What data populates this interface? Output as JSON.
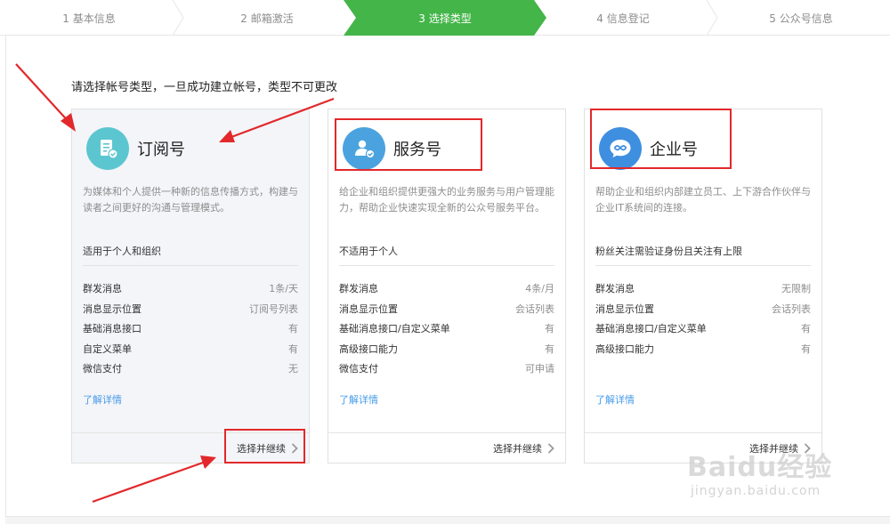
{
  "steps": [
    {
      "label": "1 基本信息"
    },
    {
      "label": "2 邮箱激活"
    },
    {
      "label": "3 选择类型"
    },
    {
      "label": "4 信息登记"
    },
    {
      "label": "5 公众号信息"
    }
  ],
  "intro": "请选择帐号类型，一旦成功建立帐号，类型不可更改",
  "cards": [
    {
      "icon": "subscription-doc-icon",
      "icon_color": "#5cc6d0",
      "title": "订阅号",
      "desc": "为媒体和个人提供一种新的信息传播方式，构建与读者之间更好的沟通与管理模式。",
      "suit": "适用于个人和组织",
      "features": [
        {
          "k": "群发消息",
          "v": "1条/天"
        },
        {
          "k": "消息显示位置",
          "v": "订阅号列表"
        },
        {
          "k": "基础消息接口",
          "v": "有"
        },
        {
          "k": "自定义菜单",
          "v": "有"
        },
        {
          "k": "微信支付",
          "v": "无"
        }
      ],
      "more": "了解详情",
      "continue": "选择并继续"
    },
    {
      "icon": "service-person-icon",
      "icon_color": "#4aa3df",
      "title": "服务号",
      "desc": "给企业和组织提供更强大的业务服务与用户管理能力，帮助企业快速实现全新的公众号服务平台。",
      "suit": "不适用于个人",
      "features": [
        {
          "k": "群发消息",
          "v": "4条/月"
        },
        {
          "k": "消息显示位置",
          "v": "会话列表"
        },
        {
          "k": "基础消息接口/自定义菜单",
          "v": "有"
        },
        {
          "k": "高级接口能力",
          "v": "有"
        },
        {
          "k": "微信支付",
          "v": "可申请"
        }
      ],
      "more": "了解详情",
      "continue": "选择并继续"
    },
    {
      "icon": "enterprise-chat-icon",
      "icon_color": "#3f8fe0",
      "title": "企业号",
      "desc": "帮助企业和组织内部建立员工、上下游合作伙伴与企业IT系统间的连接。",
      "suit": "粉丝关注需验证身份且关注有上限",
      "features": [
        {
          "k": "群发消息",
          "v": "无限制"
        },
        {
          "k": "消息显示位置",
          "v": "会话列表"
        },
        {
          "k": "基础消息接口/自定义菜单",
          "v": "有"
        },
        {
          "k": "高级接口能力",
          "v": "有"
        }
      ],
      "more": "了解详情",
      "continue": "选择并继续"
    }
  ],
  "watermark": {
    "brand": "Baidu经验",
    "url": "jingyan.baidu.com"
  },
  "colors": {
    "active_step": "#44b549",
    "annotation": "#e2282b",
    "link": "#459ae9"
  }
}
